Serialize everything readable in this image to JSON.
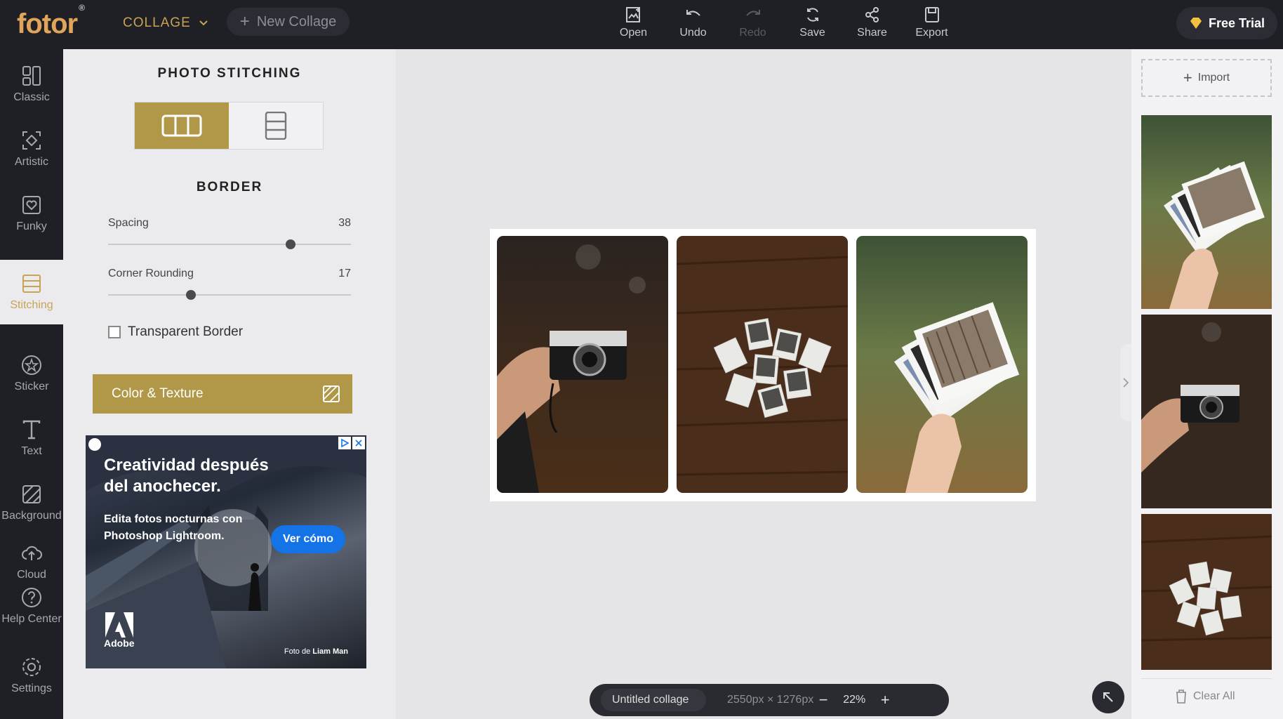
{
  "app": {
    "logo": "fotor",
    "logo_mark": "®"
  },
  "header": {
    "mode_label": "COLLAGE",
    "new_collage_label": "New Collage",
    "tools": [
      {
        "label": "Open",
        "icon": "open-image-icon",
        "enabled": true
      },
      {
        "label": "Undo",
        "icon": "undo-icon",
        "enabled": true
      },
      {
        "label": "Redo",
        "icon": "redo-icon",
        "enabled": false
      },
      {
        "label": "Save",
        "icon": "save-sync-icon",
        "enabled": true
      },
      {
        "label": "Share",
        "icon": "share-icon",
        "enabled": true
      },
      {
        "label": "Export",
        "icon": "export-icon",
        "enabled": true
      }
    ],
    "free_trial_label": "Free Trial"
  },
  "leftnav": {
    "items": [
      {
        "label": "Classic",
        "icon": "classic-grid-icon",
        "active": false
      },
      {
        "label": "Artistic",
        "icon": "artistic-icon",
        "active": false
      },
      {
        "label": "Funky",
        "icon": "funky-heart-icon",
        "active": false
      },
      {
        "label": "Stitching",
        "icon": "stitching-icon",
        "active": true
      },
      {
        "label": "Sticker",
        "icon": "sticker-star-icon",
        "active": false
      },
      {
        "label": "Text",
        "icon": "text-t-icon",
        "active": false
      },
      {
        "label": "Background",
        "icon": "background-icon",
        "active": false
      },
      {
        "label": "Cloud",
        "icon": "cloud-upload-icon",
        "active": false
      },
      {
        "label": "Help Center",
        "icon": "help-icon",
        "active": false
      },
      {
        "label": "Settings",
        "icon": "gear-icon",
        "active": false
      }
    ]
  },
  "panel": {
    "title": "PHOTO STITCHING",
    "layout_selected": "horizontal",
    "border_title": "BORDER",
    "spacing": {
      "label": "Spacing",
      "value": "38",
      "fraction": 0.75
    },
    "corner_rounding": {
      "label": "Corner Rounding",
      "value": "17",
      "fraction": 0.34
    },
    "transparent_border_label": "Transparent Border",
    "transparent_border_checked": false,
    "color_texture_label": "Color & Texture",
    "accent_color": "#b19848"
  },
  "ad": {
    "headline": "Creatividad después del anochecer.",
    "body": "Edita fotos nocturnas con Photoshop Lightroom.",
    "cta": "Ver cómo",
    "brand": "Adobe",
    "credit_prefix": "Foto de ",
    "credit_name": "Liam Man"
  },
  "canvas": {
    "document_name": "Untitled collage",
    "dimensions": "2550px × 1276px",
    "zoom": "22%"
  },
  "rightpanel": {
    "import_label": "Import",
    "clear_all_label": "Clear All"
  }
}
